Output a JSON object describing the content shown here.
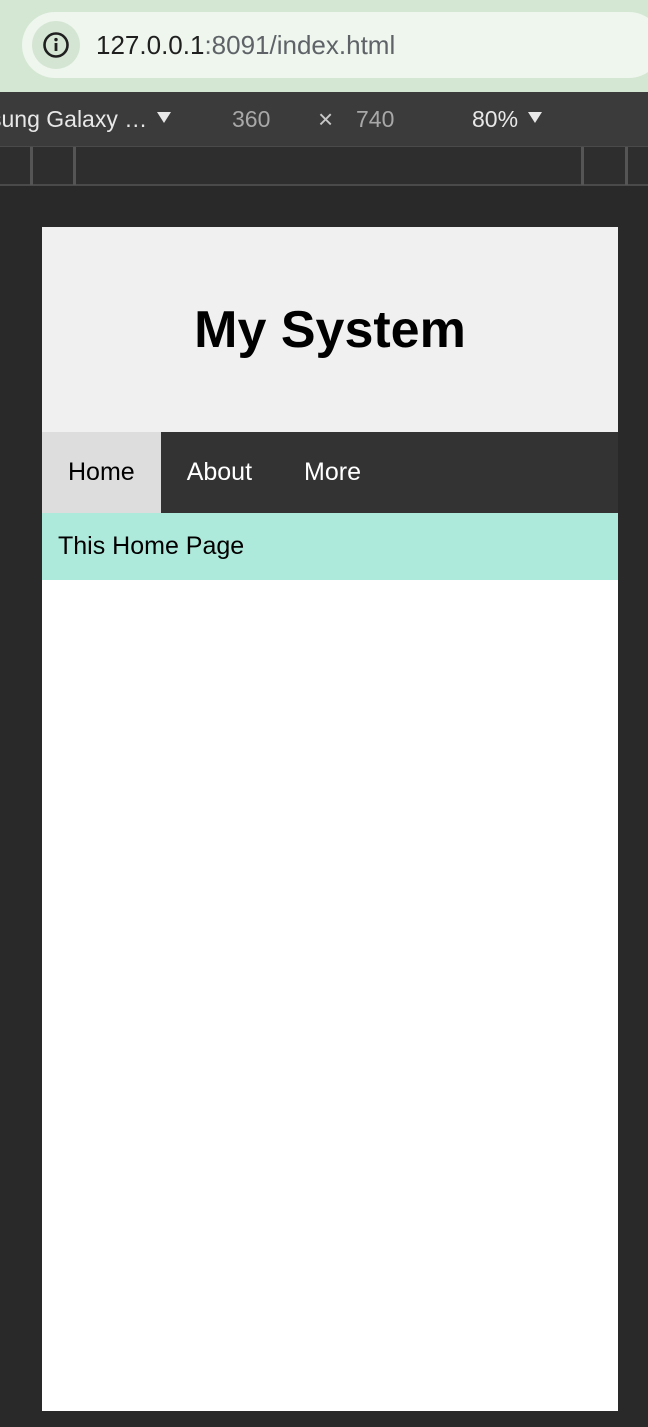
{
  "browser": {
    "url_host": "127.0.0.1",
    "url_rest": ":8091/index.html",
    "info_icon": "info-icon"
  },
  "device_toolbar": {
    "device_name": "sung Galaxy …",
    "width": "360",
    "times": "×",
    "height": "740",
    "zoom": "80%"
  },
  "page": {
    "title": "My System",
    "nav": [
      {
        "label": "Home",
        "active": true
      },
      {
        "label": "About",
        "active": false
      },
      {
        "label": "More",
        "active": false
      }
    ],
    "banner_text": "This Home Page",
    "colors": {
      "header_bg": "#f0f0f0",
      "nav_bg": "#333333",
      "nav_active_bg": "#dddddd",
      "banner_bg": "#aeeadc"
    }
  }
}
